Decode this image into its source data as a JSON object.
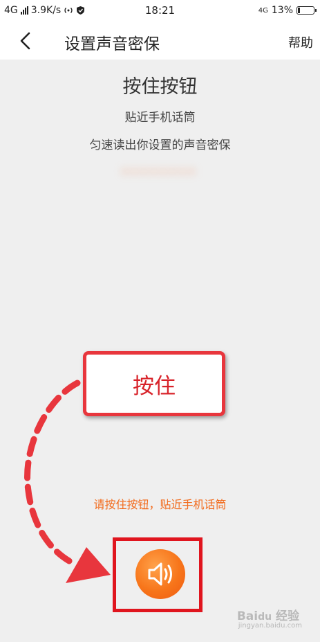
{
  "status_bar": {
    "network": "4G",
    "speed": "3.9K/s",
    "time": "18:21",
    "network_right": "4G",
    "battery_percent": "13%",
    "battery_level": 0.13
  },
  "navbar": {
    "title": "设置声音密保",
    "help_label": "帮助"
  },
  "content": {
    "main_title": "按住按钮",
    "instruction_1": "贴近手机话筒",
    "instruction_2": "匀速读出你设置的声音密保",
    "secret_phrase": "••••••••"
  },
  "annotation": {
    "press_label": "按住"
  },
  "hint_text": "请按住按钮，贴近手机话筒",
  "colors": {
    "accent_orange": "#f26a1b",
    "annotation_red": "#e8363d"
  },
  "icons": {
    "back": "chevron-left-icon",
    "speaker": "speaker-icon"
  }
}
